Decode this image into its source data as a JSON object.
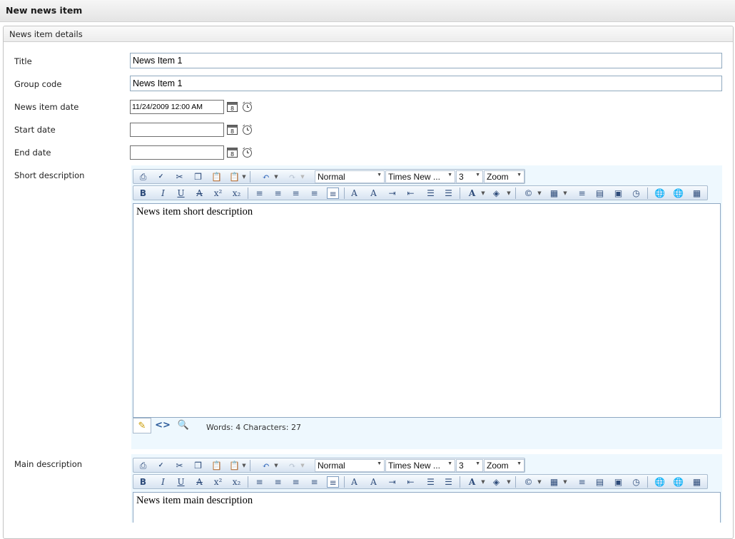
{
  "page": {
    "title": "New news item"
  },
  "panel": {
    "title": "News item details"
  },
  "form": {
    "title": {
      "label": "Title",
      "value": "News Item 1"
    },
    "group_code": {
      "label": "Group code",
      "value": "News Item 1"
    },
    "news_item_date": {
      "label": "News item date",
      "value": "11/24/2009 12:00 AM"
    },
    "start_date": {
      "label": "Start date",
      "value": ""
    },
    "end_date": {
      "label": "End date",
      "value": ""
    },
    "short_description": {
      "label": "Short description"
    },
    "main_description": {
      "label": "Main description"
    }
  },
  "editor_short": {
    "paragraph_format": "Normal",
    "font_name": "Times New ...",
    "font_size": "3",
    "zoom": "Zoom",
    "content": "News item short description",
    "word_count": "Words: 4  Characters: 27"
  },
  "editor_main": {
    "paragraph_format": "Normal",
    "font_name": "Times New ...",
    "font_size": "3",
    "zoom": "Zoom",
    "content": "News item main description"
  },
  "toolbar_icons": {
    "row1": [
      "print",
      "spellcheck",
      "cut",
      "copy",
      "paste",
      "paste-options",
      "undo",
      "redo"
    ],
    "row2": [
      "bold",
      "italic",
      "underline",
      "strikethrough",
      "superscript",
      "subscript",
      "align-left",
      "align-center",
      "align-right",
      "justify",
      "remove-alignment",
      "indent",
      "outdent",
      "numbered-list",
      "bulleted-list",
      "font-color",
      "highlight-color",
      "symbol",
      "table",
      "format-stripper",
      "snippets",
      "paste-word",
      "insert-date",
      "hyperlink",
      "remove-link",
      "image-manager"
    ]
  },
  "colors": {
    "accent": "#8fa9bf",
    "editor_bg": "#eef8fe",
    "toolbar_border": "#a9bccf"
  }
}
